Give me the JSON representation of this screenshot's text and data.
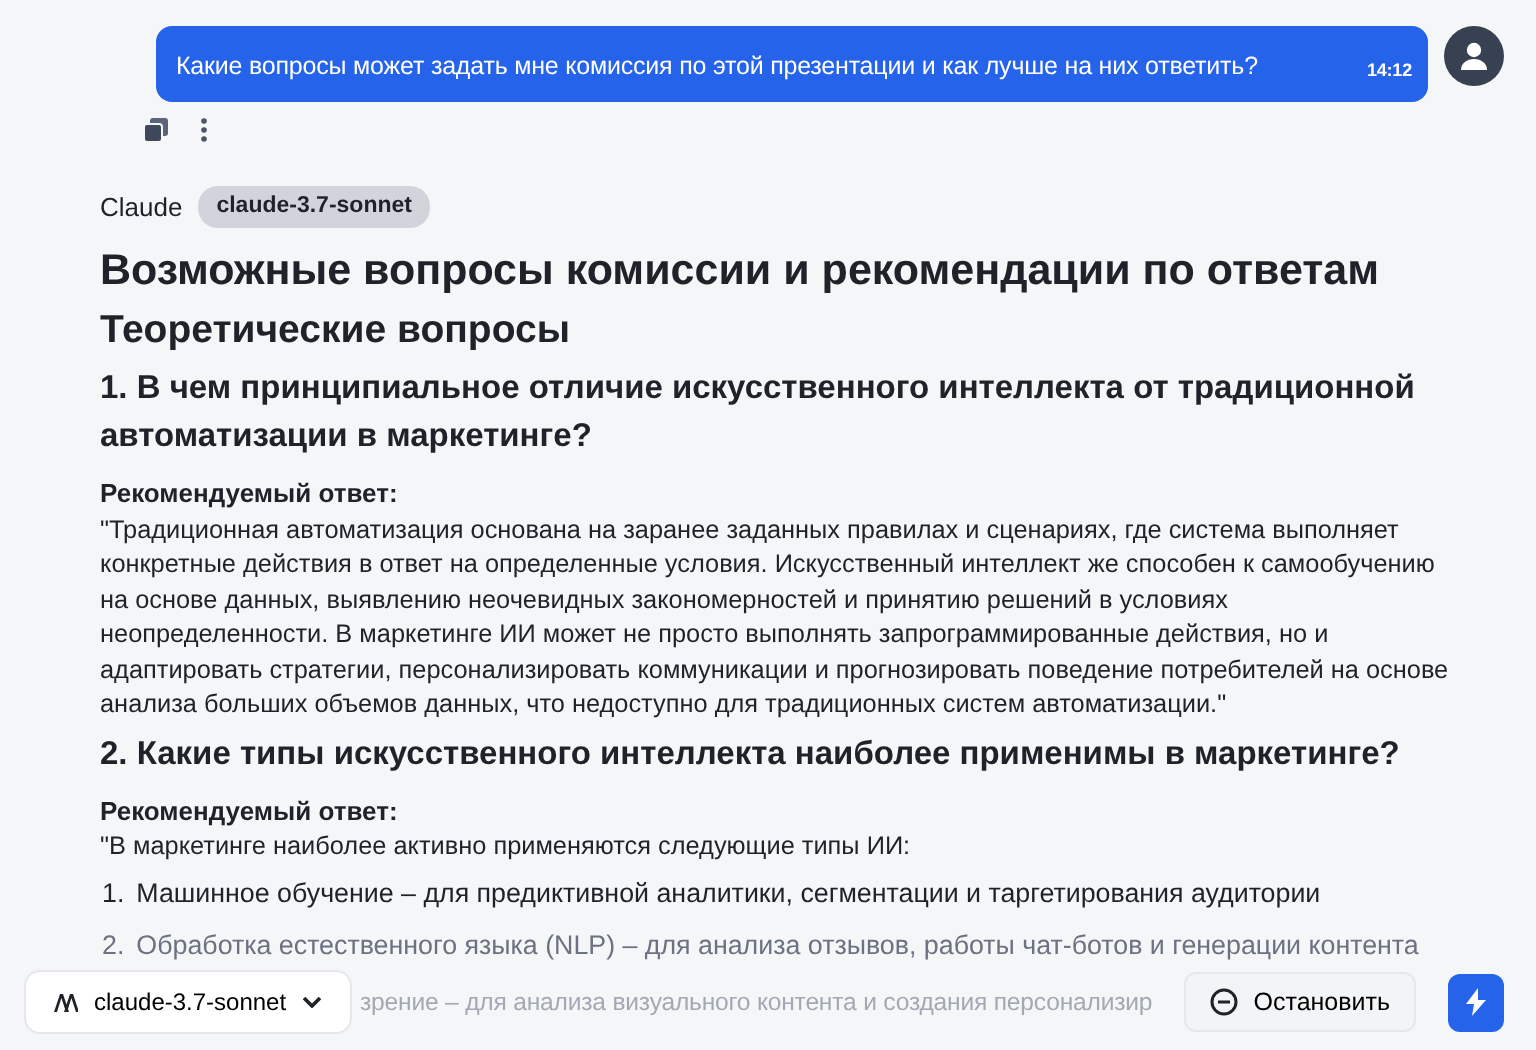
{
  "user_message": {
    "text": "Какие вопросы может задать мне комиссия по этой презентации и как лучше на них ответить?",
    "time": "14:12"
  },
  "assistant": {
    "name": "Claude",
    "model_badge": "claude-3.7-sonnet"
  },
  "content": [
    {
      "kind": "h1",
      "text": "Возможные вопросы комиссии и рекомендации по ответам"
    },
    {
      "kind": "h2",
      "text": "Теоретические вопросы"
    },
    {
      "kind": "h3",
      "text": "1. В чем принципиальное отличие искусственного интеллекта от традиционной автоматизации в маркетинге?"
    },
    {
      "kind": "label",
      "text": "Рекомендуемый ответ:"
    },
    {
      "kind": "p",
      "text": "\"Традиционная автоматизация основана на заранее заданных правилах и сценариях, где система выполняет конкретные действия в ответ на определенные условия. Искусственный интеллект же способен к самообучению на основе данных, выявлению неочевидных закономерностей и принятию решений в условиях неопределенности. В маркетинге ИИ может не просто выполнять запрограммированные действия, но и адаптировать стратегии, персонализировать коммуникации и прогнозировать поведение потребителей на основе анализа больших объемов данных, что недоступно для традиционных систем автоматизации.\""
    },
    {
      "kind": "h3",
      "text": "2. Какие типы искусственного интеллекта наиболее применимы в маркетинге?"
    },
    {
      "kind": "label",
      "text": "Рекомендуемый ответ:"
    },
    {
      "kind": "p",
      "text": "\"В маркетинге наиболее активно применяются следующие типы ИИ:"
    },
    {
      "kind": "li",
      "marker": "1.",
      "text": "Машинное обучение – для предиктивной аналитики, сегментации и таргетирования аудитории"
    },
    {
      "kind": "li",
      "marker": "2.",
      "text": "Обработка естественного языка (NLP) – для анализа отзывов, работы чат-ботов и генерации контента"
    },
    {
      "kind": "li_partial",
      "text": "зрение – для анализа визуального контента и создания персонализир"
    }
  ],
  "composer": {
    "model": "claude-3.7-sonnet",
    "stop_button": "Остановить"
  }
}
